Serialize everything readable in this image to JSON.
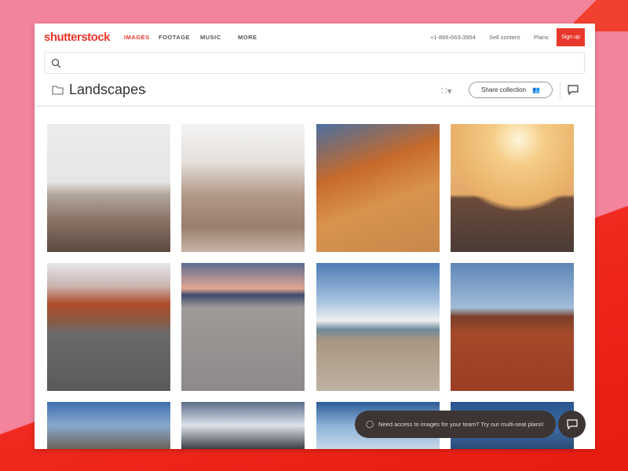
{
  "header": {
    "logo": "shutterstock",
    "nav": [
      "IMAGES",
      "FOOTAGE",
      "MUSIC",
      "MORE"
    ],
    "phone": "+1-866-663-3954",
    "sell": "Sell content",
    "plans": "Plans",
    "signup": "Sign up"
  },
  "search": {
    "placeholder": ""
  },
  "collection": {
    "title": "Landscapes",
    "share": "Share collection"
  },
  "toast": {
    "text": "Need access to images for your team? Try our multi-seat plans!"
  },
  "colors": {
    "brand": "#e8382b",
    "toast": "#3d3533"
  }
}
